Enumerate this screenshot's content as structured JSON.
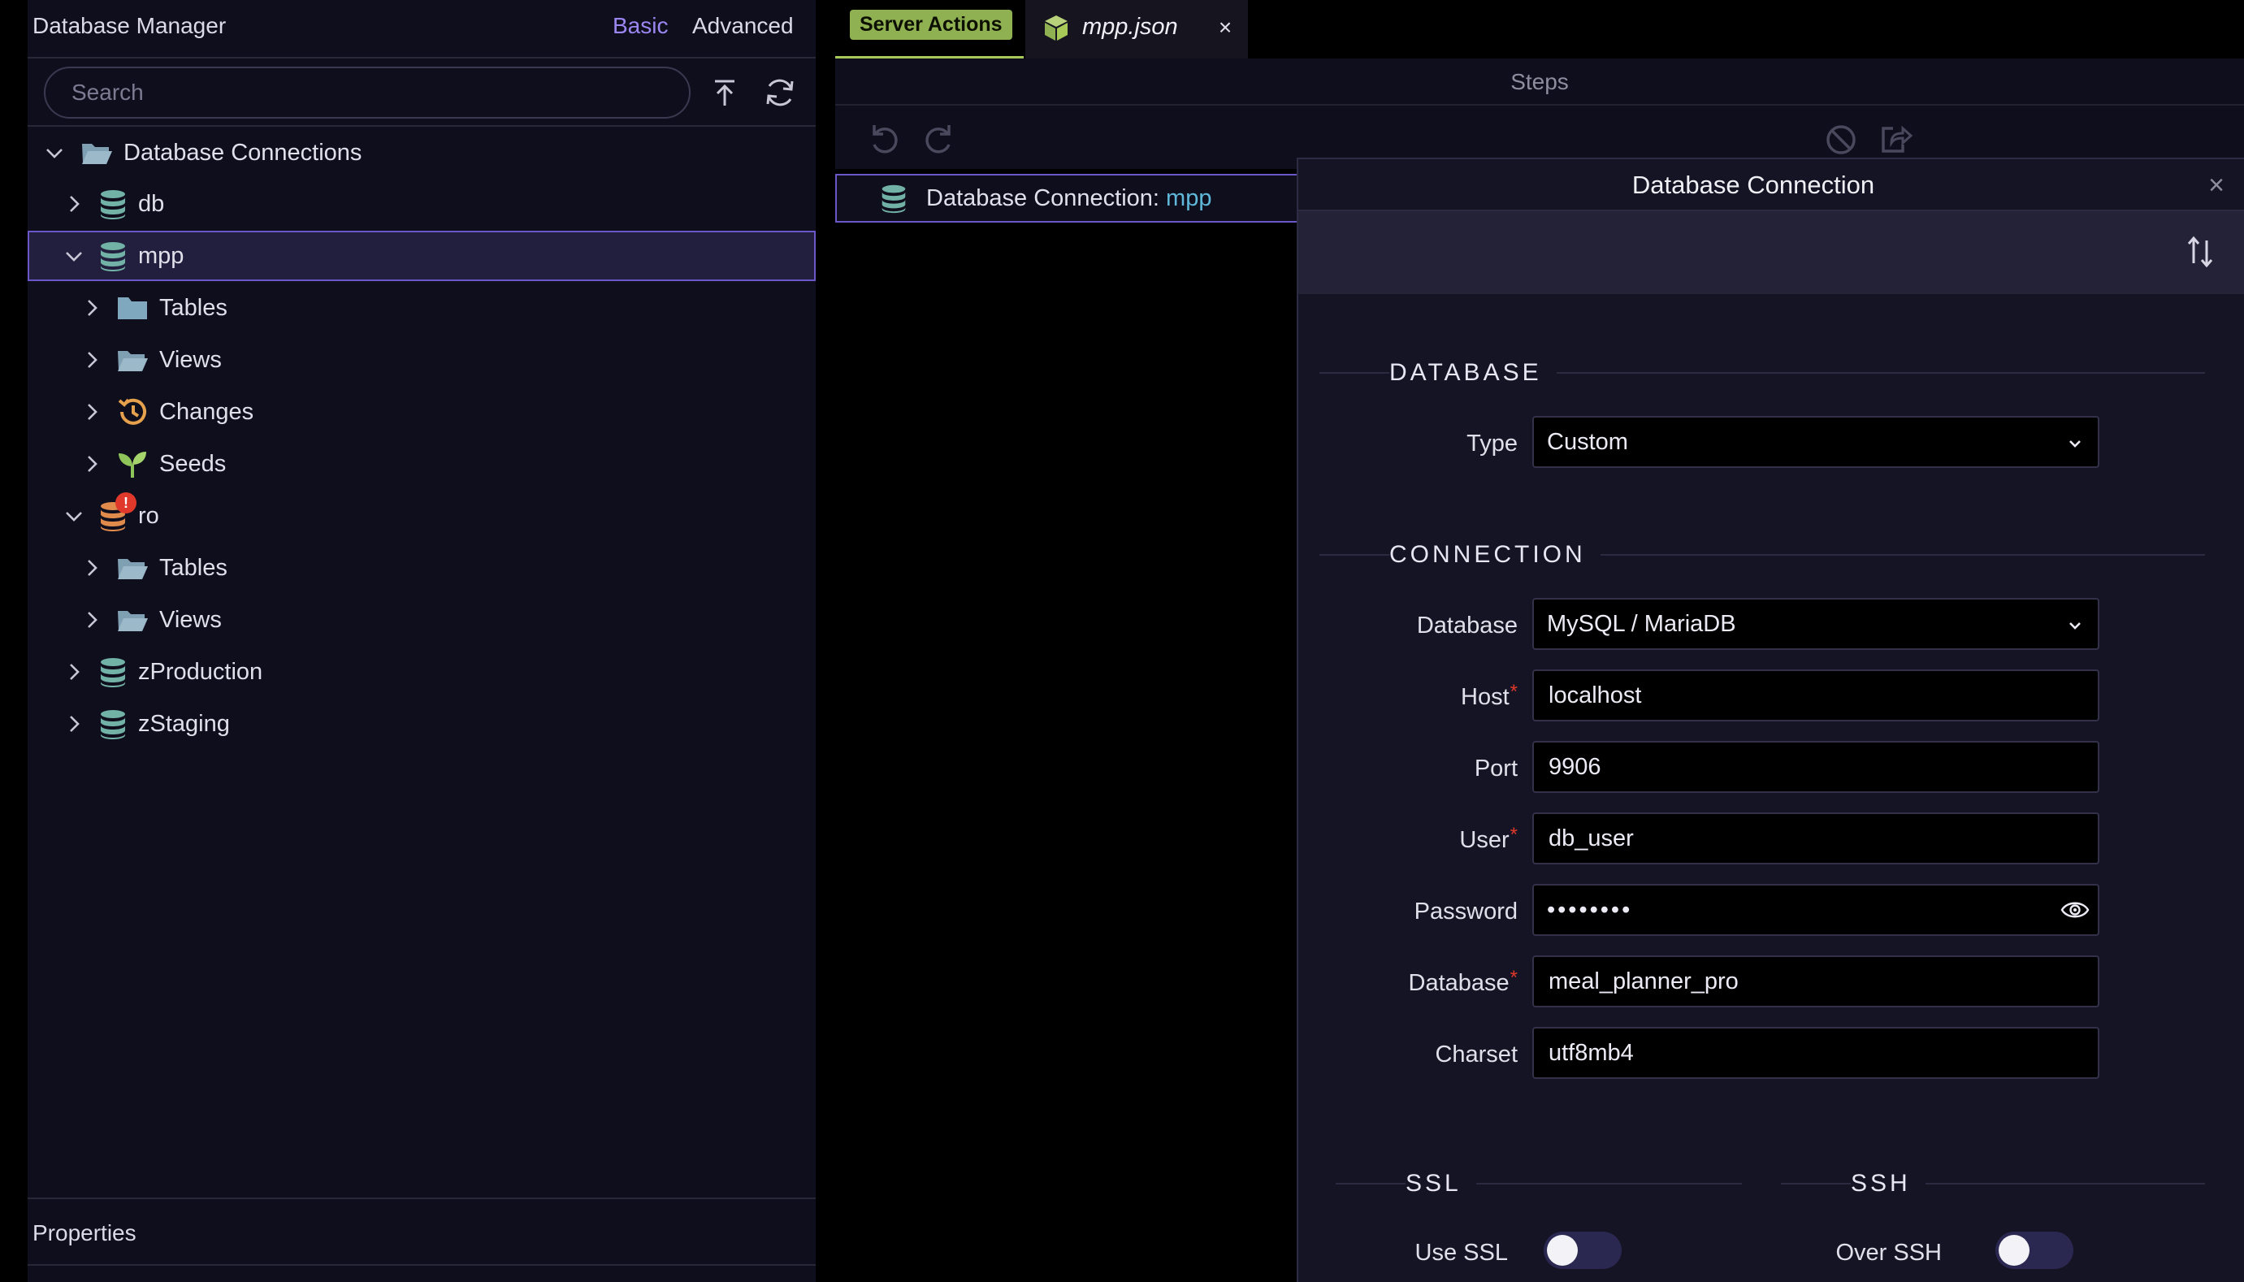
{
  "left_panel": {
    "title": "Database Manager",
    "modes": {
      "basic": "Basic",
      "advanced": "Advanced"
    },
    "search": {
      "placeholder": "Search",
      "value": ""
    },
    "tree": [
      {
        "label": "Database Connections",
        "icon": "folder-open-icon",
        "expanded": true
      },
      {
        "label": "db",
        "icon": "database-icon",
        "expanded": false
      },
      {
        "label": "mpp",
        "icon": "database-icon",
        "expanded": true,
        "selected": true
      },
      {
        "label": "Tables",
        "icon": "folder-icon"
      },
      {
        "label": "Views",
        "icon": "folder-open-icon"
      },
      {
        "label": "Changes",
        "icon": "history-icon"
      },
      {
        "label": "Seeds",
        "icon": "seedling-icon"
      },
      {
        "label": "ro",
        "icon": "database-error-icon",
        "expanded": true,
        "badge": "!"
      },
      {
        "label": "Tables",
        "icon": "folder-open-icon"
      },
      {
        "label": "Views",
        "icon": "folder-open-icon"
      },
      {
        "label": "zProduction",
        "icon": "database-icon"
      },
      {
        "label": "zStaging",
        "icon": "database-icon"
      }
    ],
    "properties_title": "Properties"
  },
  "tabs": {
    "server_actions": "Server Actions",
    "file": "mpp.json",
    "close": "×"
  },
  "steps": {
    "label": "Steps",
    "row_prefix": "Database Connection:",
    "row_name": "mpp"
  },
  "dialog": {
    "title": "Database Connection",
    "close": "×",
    "database_section": "DATABASE",
    "type_label": "Type",
    "type_value": "Custom",
    "connection_section": "CONNECTION",
    "fields": {
      "database_type_label": "Database",
      "database_type_value": "MySQL / MariaDB",
      "host_label": "Host",
      "host_value": "localhost",
      "port_label": "Port",
      "port_value": "9906",
      "user_label": "User",
      "user_value": "db_user",
      "password_label": "Password",
      "password_value": "••••••••",
      "dbname_label": "Database",
      "dbname_value": "meal_planner_pro",
      "charset_label": "Charset",
      "charset_value": "utf8mb4",
      "required_marker": "*"
    },
    "ssl_section": "SSL",
    "use_ssl_label": "Use SSL",
    "use_ssl_on": false,
    "ssh_section": "SSH",
    "over_ssh_label": "Over SSH",
    "over_ssh_on": false
  },
  "colors": {
    "accent": "#9b86f2",
    "selection_border": "#6b57c8",
    "server_actions_tab": "#8fb152",
    "database_icon": "#72b1a6",
    "required": "#e0392b"
  }
}
